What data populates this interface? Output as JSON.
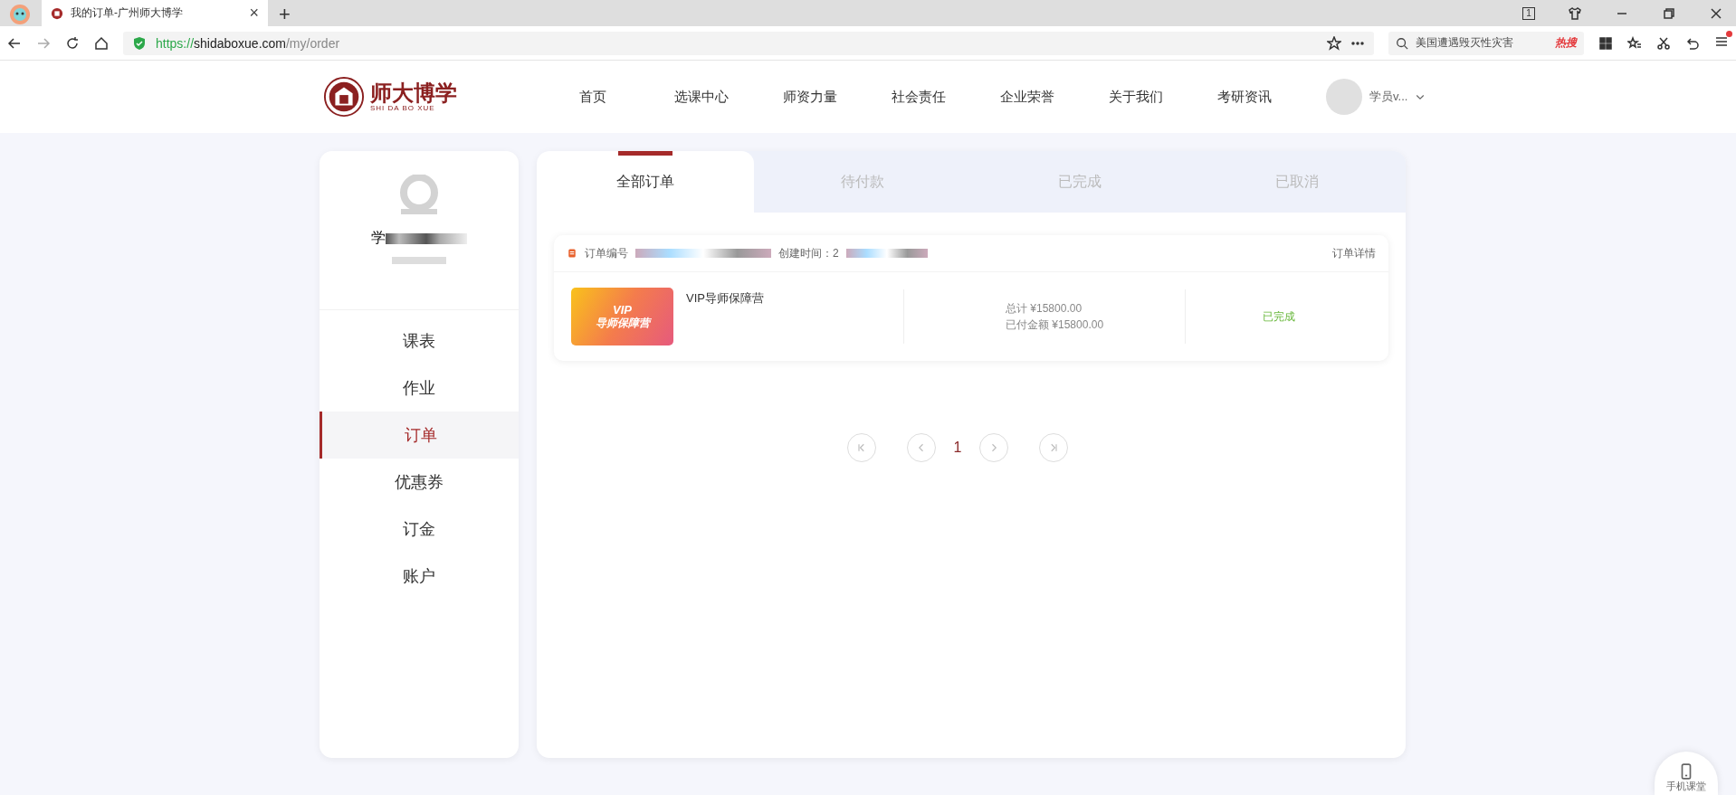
{
  "browser": {
    "tab": {
      "title": "我的订单-广州师大博学",
      "close": "×"
    },
    "new_tab": "+",
    "tab_counter": "1",
    "url": {
      "scheme": "https://",
      "host": "shidaboxue.com",
      "path": "/my/order"
    },
    "search": {
      "value": "美国遭遇毁灭性灾害",
      "hot_label": "热搜"
    }
  },
  "site": {
    "logo": {
      "name": "师大博学",
      "subtitle": "SHI DA BO XUE"
    },
    "nav": [
      {
        "label": "首页"
      },
      {
        "label": "选课中心"
      },
      {
        "label": "师资力量"
      },
      {
        "label": "社会责任"
      },
      {
        "label": "企业荣誉"
      },
      {
        "label": "关于我们"
      },
      {
        "label": "考研资讯"
      }
    ],
    "user": "学员v..."
  },
  "profile": {
    "name": "学"
  },
  "menu": [
    {
      "label": "课表",
      "selected": false
    },
    {
      "label": "作业",
      "selected": false
    },
    {
      "label": "订单",
      "selected": true
    },
    {
      "label": "优惠券",
      "selected": false
    },
    {
      "label": "订金",
      "selected": false
    },
    {
      "label": "账户",
      "selected": false
    }
  ],
  "tabs": [
    {
      "label": "全部订单",
      "selected": true
    },
    {
      "label": "待付款",
      "selected": false
    },
    {
      "label": "已完成",
      "selected": false
    },
    {
      "label": "已取消",
      "selected": false
    }
  ],
  "orders": [
    {
      "number_label": "订单编号",
      "created_label": "创建时间：2",
      "detail_link": "订单详情",
      "thumbnail": {
        "line_1": "VIP",
        "line_2": "导师保障营"
      },
      "title": "VIP导师保障营",
      "total": "总计 ¥15800.00",
      "paid": "已付金额 ¥15800.00",
      "status": "已完成"
    }
  ],
  "pagination": {
    "pages": [
      {
        "label": "1",
        "selected": true
      }
    ]
  },
  "floating_button": "手机课堂"
}
